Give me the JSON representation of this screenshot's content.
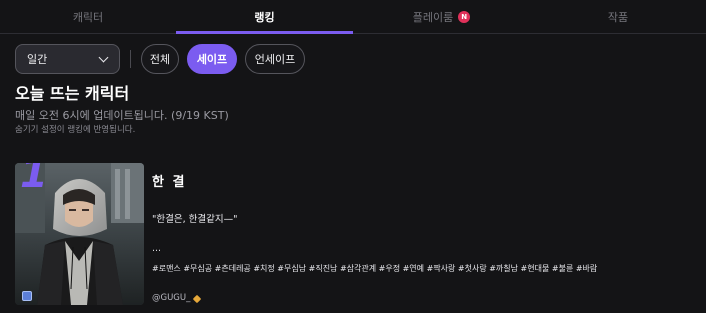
{
  "tabs": [
    {
      "label": "캐릭터"
    },
    {
      "label": "랭킹"
    },
    {
      "label": "플레이룸",
      "badge": "N"
    },
    {
      "label": "작품"
    }
  ],
  "active_tab": "랭킹",
  "filters": {
    "period": "일간",
    "chips": [
      "전체",
      "세이프",
      "언세이프"
    ],
    "active_chip": "세이프"
  },
  "section": {
    "title": "오늘 뜨는 캐릭터",
    "update_info": "매일 오전 6시에 업데이트됩니다. (9/19 KST)",
    "note": "숨기기 설정이 랭킹에 반영됩니다."
  },
  "ranking": [
    {
      "rank": "1",
      "name": "한 결",
      "quote": "\"한결은, 한결같지—\"",
      "ellipsis": "...",
      "tags": "#로맨스 #무심공 #츤데레공 #치정 #무심남 #직진남 #삼각관계 #우정 #연예 #짝사랑 #첫사랑 #까칠남 #현대물 #불륜 #바람",
      "author": "@GUGU_",
      "author_icon": "gold-diamond-icon"
    }
  ],
  "colors": {
    "accent": "#7b5cf0",
    "background": "#141416",
    "badge": "#e0315a"
  }
}
